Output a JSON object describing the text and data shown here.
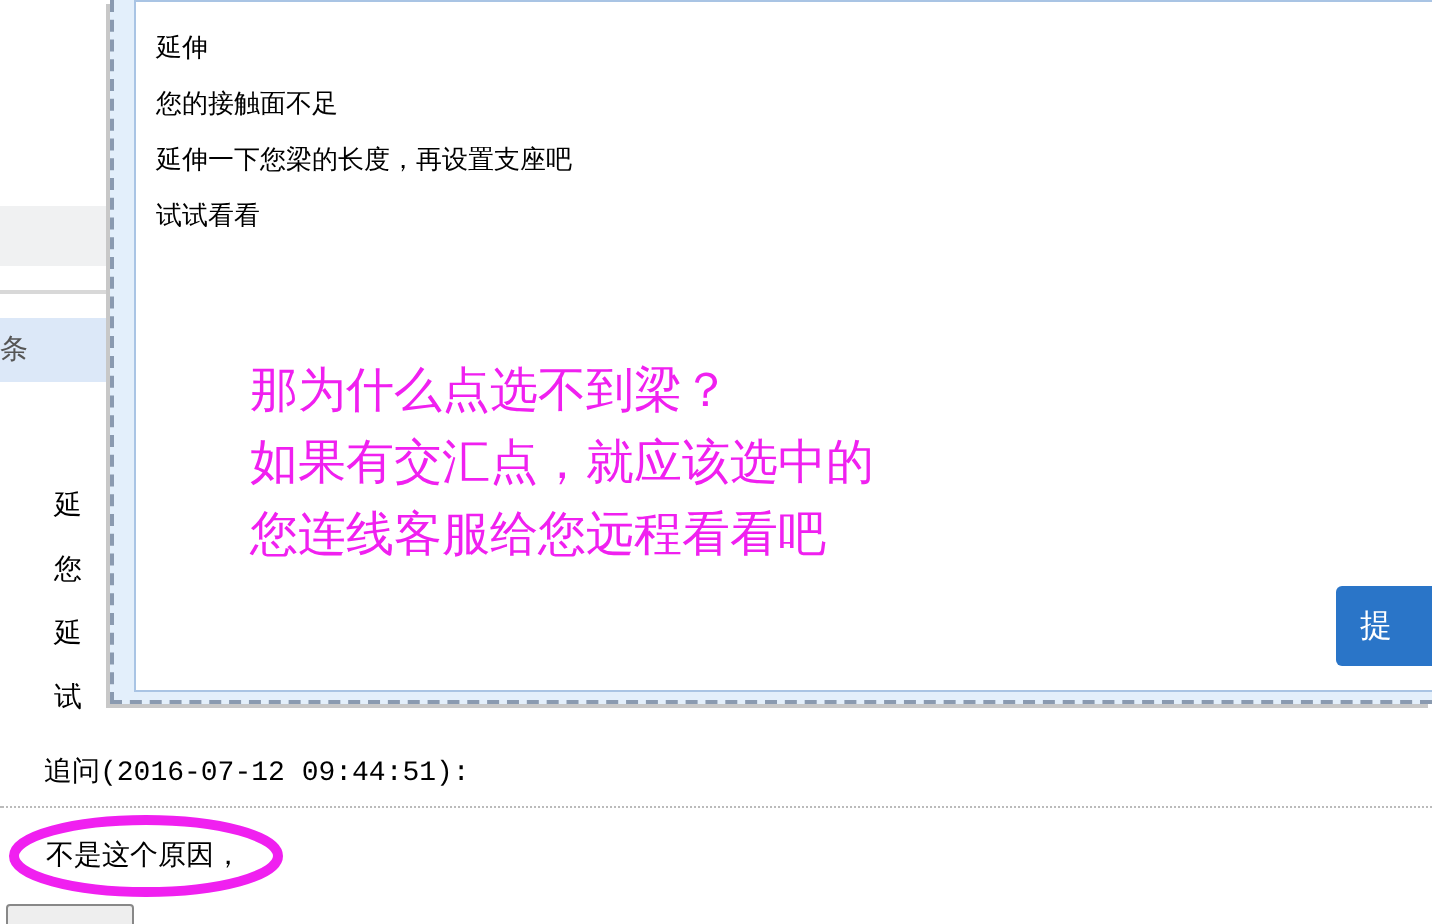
{
  "page": {
    "sidebar_fragment": "条",
    "answer_fragments": [
      "延",
      "您",
      "延",
      "试"
    ],
    "follow_up_label": "追问(2016-07-12 09:44:51):",
    "follow_up_text": "不是这个原因，"
  },
  "dialog": {
    "lines": [
      "延伸",
      "您的接触面不足",
      "延伸一下您梁的长度，再设置支座吧",
      "试试看看"
    ],
    "annotation_lines": [
      "那为什么点选不到梁？",
      "如果有交汇点，就应该选中的",
      "您连线客服给您远程看看吧"
    ],
    "submit_button": "提"
  }
}
